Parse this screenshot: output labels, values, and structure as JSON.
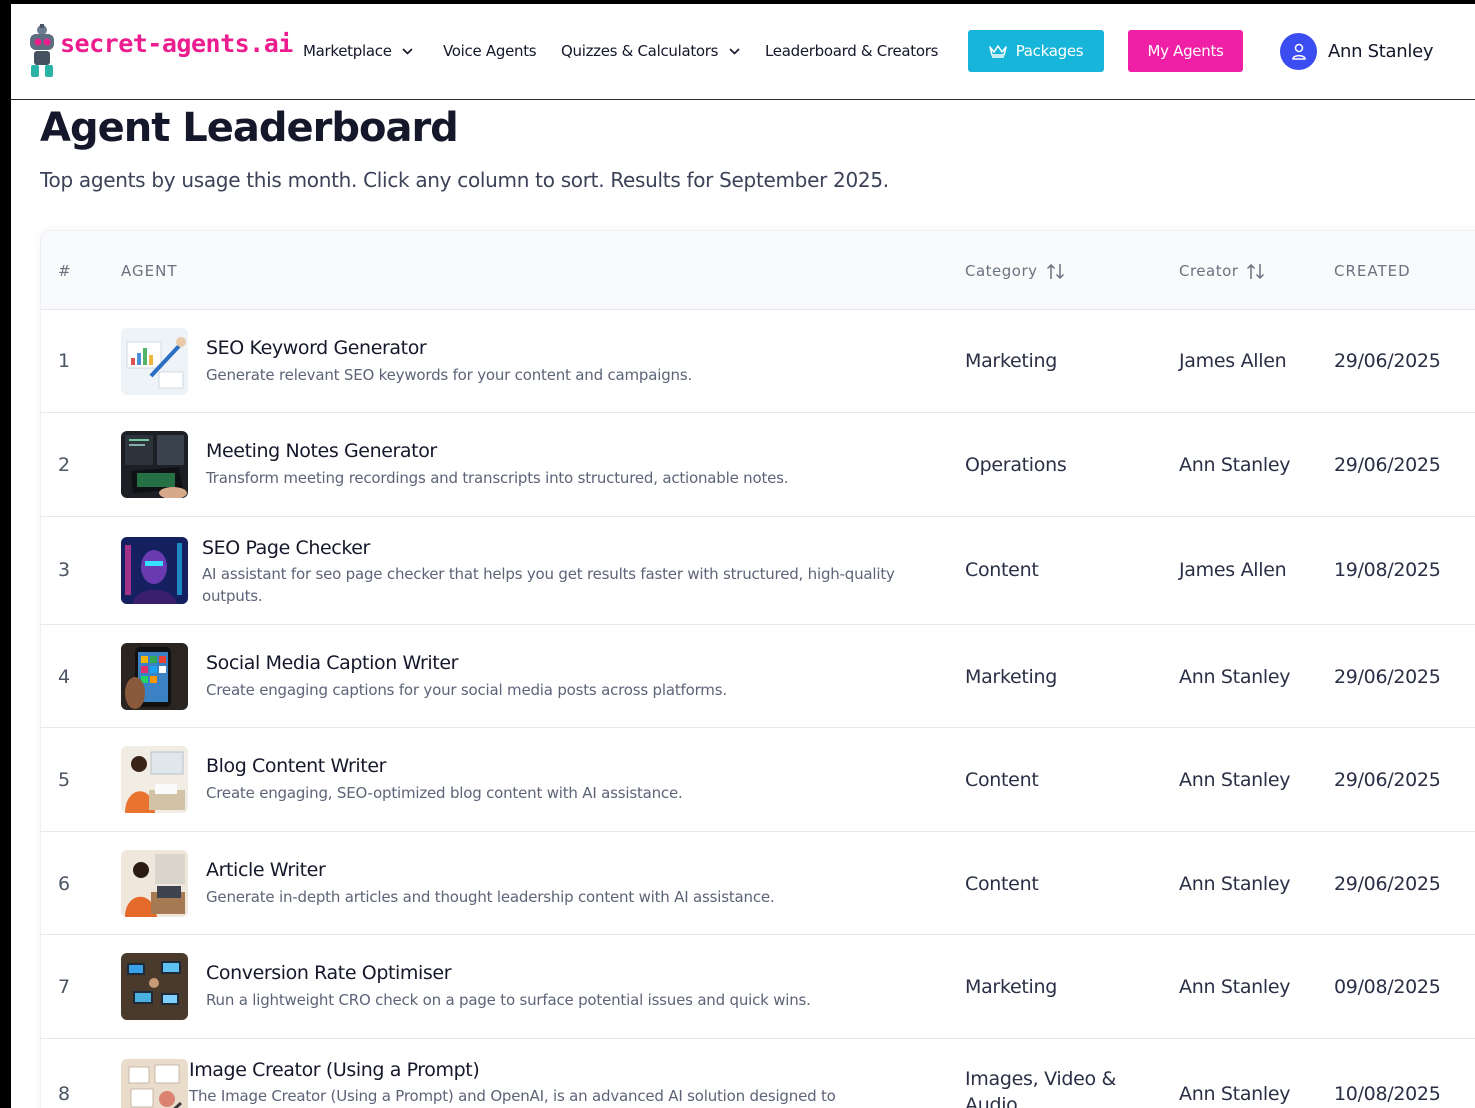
{
  "brand": {
    "name": "secret-agents.ai",
    "color": "#ec1d8f"
  },
  "nav": {
    "marketplace": "Marketplace",
    "voice_agents": "Voice Agents",
    "quizzes": "Quizzes & Calculators",
    "leaderboard": "Leaderboard & Creators",
    "packages": "Packages",
    "my_agents": "My Agents",
    "user_name": "Ann Stanley",
    "icons": {
      "dropdown": "chevron-down-icon",
      "packages": "crown-icon",
      "avatar": "user-icon"
    }
  },
  "colors": {
    "packages_button": "#17b5d9",
    "my_agents_button": "#ef20a6",
    "avatar": "#3b4cf0"
  },
  "header": {
    "title": "Agent Leaderboard",
    "subtitle": "Top agents by usage this month. Click any column to sort. Results for September 2025."
  },
  "table": {
    "columns": {
      "rank": "#",
      "agent": "AGENT",
      "category": "Category",
      "creator": "Creator",
      "created": "CREATED"
    },
    "rows": [
      {
        "rank": "1",
        "title": "SEO Keyword Generator",
        "description": "Generate relevant SEO keywords for your content and campaigns.",
        "category": "Marketing",
        "creator": "James Allen",
        "created": "29/06/2025",
        "thumb": "seo-analytics-thumbnail"
      },
      {
        "rank": "2",
        "title": "Meeting Notes Generator",
        "description": "Transform meeting recordings and transcripts into structured, actionable notes.",
        "category": "Operations",
        "creator": "Ann Stanley",
        "created": "29/06/2025",
        "thumb": "laptop-meeting-thumbnail"
      },
      {
        "rank": "3",
        "title": "SEO Page Checker",
        "description": "AI assistant for seo page checker that helps you get results faster with structured, high-quality outputs.",
        "category": "Content",
        "creator": "James Allen",
        "created": "19/08/2025",
        "thumb": "neon-face-thumbnail"
      },
      {
        "rank": "4",
        "title": "Social Media Caption Writer",
        "description": "Create engaging captions for your social media posts across platforms.",
        "category": "Marketing",
        "creator": "Ann Stanley",
        "created": "29/06/2025",
        "thumb": "smartphone-apps-thumbnail"
      },
      {
        "rank": "5",
        "title": "Blog Content Writer",
        "description": "Create engaging, SEO-optimized blog content with AI assistance.",
        "category": "Content",
        "creator": "Ann Stanley",
        "created": "29/06/2025",
        "thumb": "writer-desk-thumbnail"
      },
      {
        "rank": "6",
        "title": "Article Writer",
        "description": "Generate in-depth articles and thought leadership content with AI assistance.",
        "category": "Content",
        "creator": "Ann Stanley",
        "created": "29/06/2025",
        "thumb": "article-writer-thumbnail"
      },
      {
        "rank": "7",
        "title": "Conversion Rate Optimiser",
        "description": "Run a lightweight CRO check on a page to surface potential issues and quick wins.",
        "category": "Marketing",
        "creator": "Ann Stanley",
        "created": "09/08/2025",
        "thumb": "team-laptops-thumbnail"
      },
      {
        "rank": "8",
        "title": "Image Creator (Using a Prompt)",
        "description": "The Image Creator (Using a Prompt) and OpenAI, is an advanced AI solution designed to",
        "category": "Images, Video & Audio",
        "creator": "Ann Stanley",
        "created": "10/08/2025",
        "thumb": "sketch-board-thumbnail"
      }
    ]
  }
}
